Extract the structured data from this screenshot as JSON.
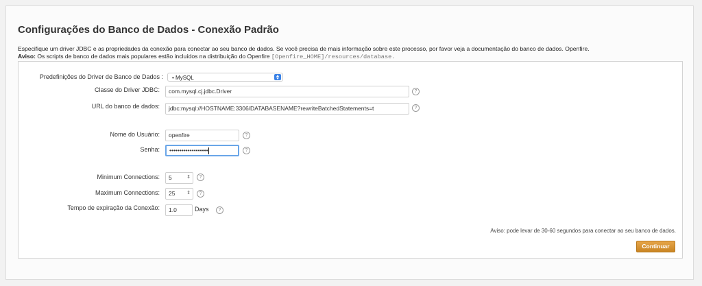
{
  "page": {
    "title": "Configurações do Banco de Dados - Conexão Padrão",
    "description": "Especifique um driver JDBC e as propriedades da conexão para conectar ao seu banco de dados. Se você precisa de mais informação sobre este processo, por favor veja a documentação do banco de dados. Openfire.",
    "notice_label": "Aviso:",
    "notice_text": "Os scripts de banco de dados mais populares estão incluídos na distribuição do Openfire",
    "notice_path": "[Openfire_HOME]/resources/database."
  },
  "form": {
    "driver_presets_label": "Predefinições do Driver de Banco de Dados :",
    "driver_presets_value": "• MySQL",
    "driver_class_label": "Classe do Driver JDBC:",
    "driver_class_value": "com.mysql.cj.jdbc.Driver",
    "db_url_label": "URL do banco de dados:",
    "db_url_value": "jdbc:mysql://HOSTNAME:3306/DATABASENAME?rewriteBatchedStatements=t",
    "username_label": "Nome do Usuário:",
    "username_value": "openfire",
    "password_label": "Senha:",
    "password_value": "•••••••••••••••••••",
    "min_conn_label": "Minimum Connections:",
    "min_conn_value": "5",
    "max_conn_label": "Maximum Connections:",
    "max_conn_value": "25",
    "timeout_label": "Tempo de expiração da Conexão:",
    "timeout_value": "1.0",
    "timeout_unit": "Days",
    "help_glyph": "?",
    "spin_glyph": "⇕"
  },
  "footer": {
    "warning": "Aviso: pode levar de 30-60 segundos para conectar ao seu banco de dados.",
    "continue_label": "Continuar"
  },
  "colors": {
    "accent": "#c98523",
    "focus": "#6aa6e8",
    "select_arrow": "#3b82e6"
  }
}
